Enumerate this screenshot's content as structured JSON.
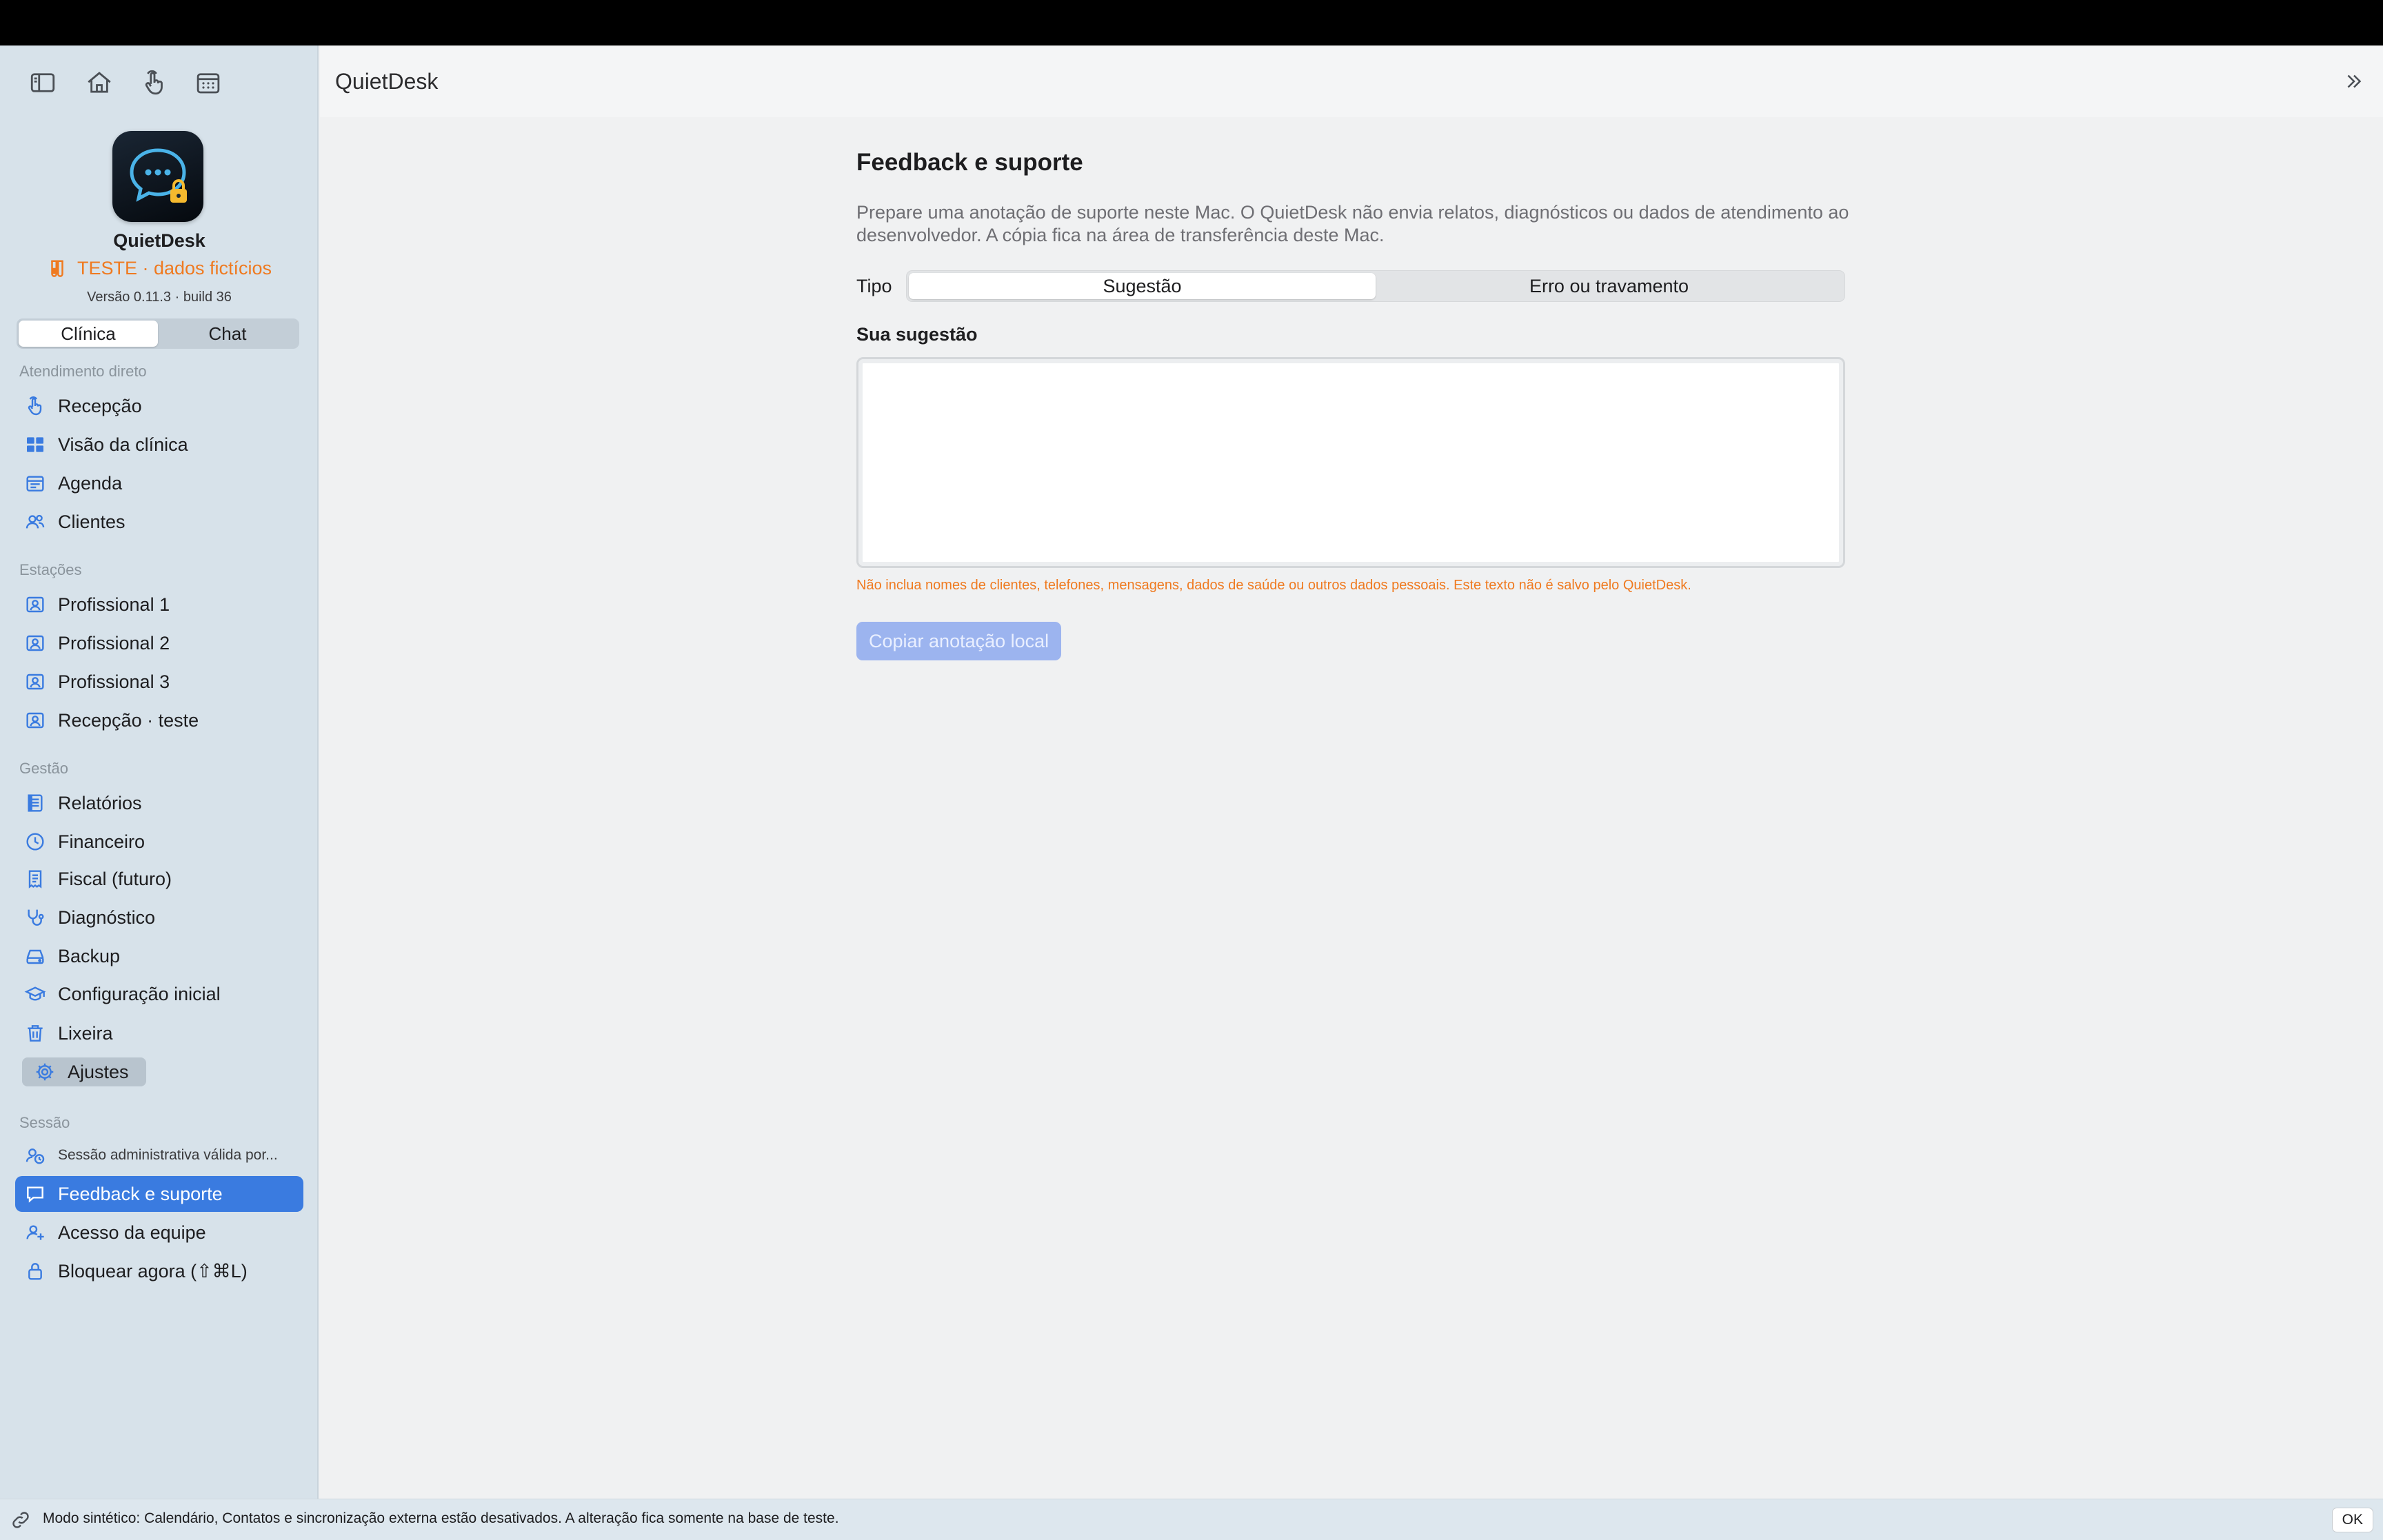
{
  "app": {
    "name": "QuietDesk",
    "test_badge": "TESTE · dados fictícios",
    "version": "Versão 0.11.3 · build 36",
    "accent_color": "#3a7be0",
    "warning_color": "#ef7a20"
  },
  "toolbar": {
    "icons": [
      "sidebar-toggle-icon",
      "home-icon",
      "tap-hand-icon",
      "calendar-grid-icon"
    ]
  },
  "mode_switch": {
    "options": [
      "Clínica",
      "Chat"
    ],
    "selected": "Clínica"
  },
  "sidebar": {
    "sections": [
      {
        "label": "Atendimento direto",
        "items": [
          {
            "label": "Recepção",
            "icon": "tap-hand-icon"
          },
          {
            "label": "Visão da clínica",
            "icon": "grid-icon"
          },
          {
            "label": "Agenda",
            "icon": "calendar-icon"
          },
          {
            "label": "Clientes",
            "icon": "people-icon"
          }
        ]
      },
      {
        "label": "Estações",
        "items": [
          {
            "label": "Profissional 1",
            "icon": "person-card-icon"
          },
          {
            "label": "Profissional 2",
            "icon": "person-card-icon"
          },
          {
            "label": "Profissional 3",
            "icon": "person-card-icon"
          },
          {
            "label": "Recepção · teste",
            "icon": "person-card-icon"
          }
        ]
      },
      {
        "label": "Gestão",
        "items": [
          {
            "label": "Relatórios",
            "icon": "document-icon"
          },
          {
            "label": "Financeiro",
            "icon": "clock-icon"
          },
          {
            "label": "Fiscal (futuro)",
            "icon": "receipt-icon"
          },
          {
            "label": "Diagnóstico",
            "icon": "stethoscope-icon"
          },
          {
            "label": "Backup",
            "icon": "drive-icon"
          },
          {
            "label": "Configuração inicial",
            "icon": "graduation-cap-icon"
          },
          {
            "label": "Lixeira",
            "icon": "trash-icon"
          },
          {
            "label": "Ajustes",
            "icon": "gear-icon"
          }
        ]
      },
      {
        "label": "Sessão",
        "items": [
          {
            "label": "Sessão administrativa válida por...",
            "icon": "admin-clock-icon"
          },
          {
            "label": "Feedback e suporte",
            "icon": "chat-bubble-icon",
            "selected": true
          },
          {
            "label": "Acesso da equipe",
            "icon": "person-plus-icon"
          },
          {
            "label": "Bloquear agora (⇧⌘L)",
            "icon": "lock-icon"
          }
        ]
      }
    ]
  },
  "header": {
    "title": "QuietDesk"
  },
  "main": {
    "heading": "Feedback e suporte",
    "description": "Prepare uma anotação de suporte neste Mac. O QuietDesk não envia relatos, diagnósticos ou dados de atendimento ao desenvolvedor. A cópia fica na área de transferência deste Mac.",
    "type_label": "Tipo",
    "type_options": [
      "Sugestão",
      "Erro ou travamento"
    ],
    "type_selected": "Sugestão",
    "field_label": "Sua sugestão",
    "field_value": "",
    "warning": "Não inclua nomes de clientes, telefones, mensagens, dados de saúde ou outros dados pessoais. Este texto não é salvo pelo QuietDesk.",
    "copy_button": "Copiar anotação local"
  },
  "footer": {
    "message": "Modo sintético: Calendário, Contatos e sincronização externa estão desativados. A alteração fica somente na base de teste.",
    "ok_label": "OK"
  }
}
